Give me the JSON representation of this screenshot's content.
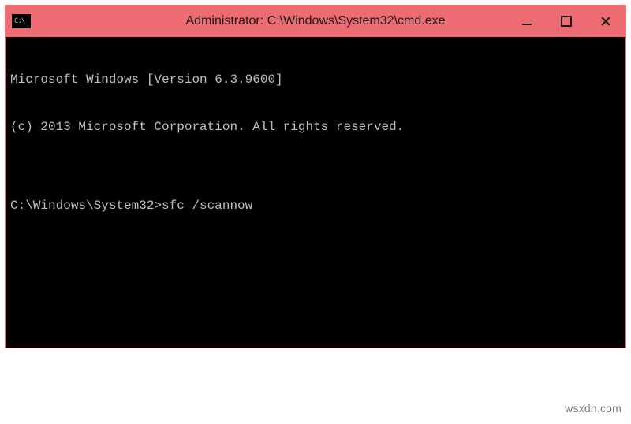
{
  "window": {
    "title": "Administrator: C:\\Windows\\System32\\cmd.exe",
    "icon_label": "C:\\",
    "colors": {
      "titlebar_bg": "#ed6b72",
      "terminal_bg": "#000000",
      "terminal_fg": "#c0c0c0"
    }
  },
  "terminal": {
    "line1": "Microsoft Windows [Version 6.3.9600]",
    "line2": "(c) 2013 Microsoft Corporation. All rights reserved.",
    "blank": "",
    "prompt": "C:\\Windows\\System32>",
    "command": "sfc /scannow"
  },
  "watermark": "wsxdn.com"
}
